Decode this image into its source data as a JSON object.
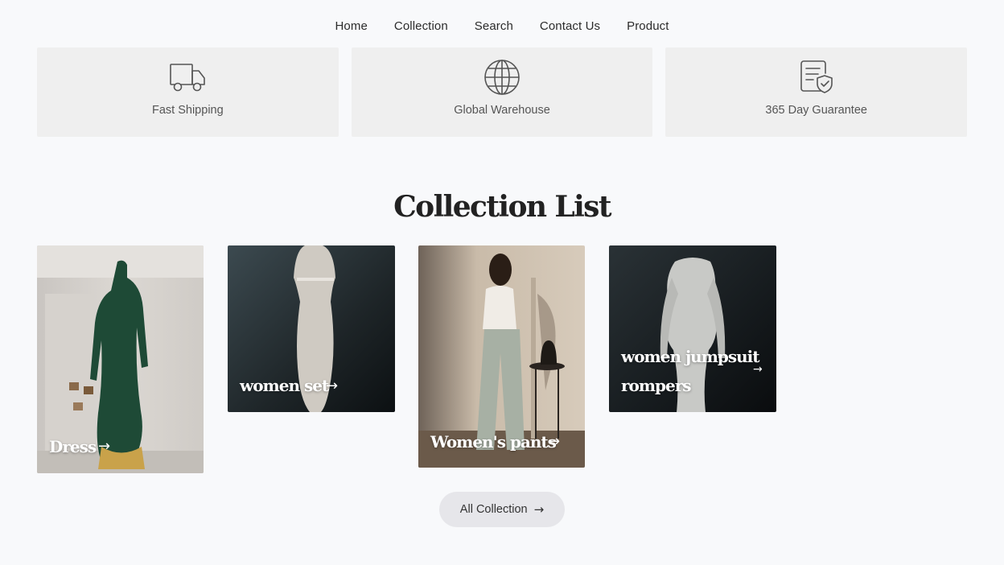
{
  "nav": {
    "items": [
      {
        "label": "Home"
      },
      {
        "label": "Collection"
      },
      {
        "label": "Search"
      },
      {
        "label": "Contact Us"
      },
      {
        "label": "Product"
      }
    ]
  },
  "features": [
    {
      "label": "Fast Shipping",
      "icon": "truck-icon"
    },
    {
      "label": "Global Warehouse",
      "icon": "globe-icon"
    },
    {
      "label": "365 Day Guarantee",
      "icon": "shield-document-icon"
    }
  ],
  "collection": {
    "title": "Collection List",
    "cards": [
      {
        "label": "Dress",
        "arrow": "→"
      },
      {
        "label": "women set",
        "arrow": "→"
      },
      {
        "label": "Women's pants",
        "arrow": "→"
      },
      {
        "label_line1": "women jumpsuit",
        "label_line2": "rompers",
        "arrow": "→"
      }
    ],
    "button_label": "All Collection",
    "button_arrow": "→"
  },
  "colors": {
    "page_bg": "#f8f9fb",
    "feature_bg": "#efefef",
    "button_bg": "#e6e6ea",
    "text": "#2b2b2b"
  }
}
